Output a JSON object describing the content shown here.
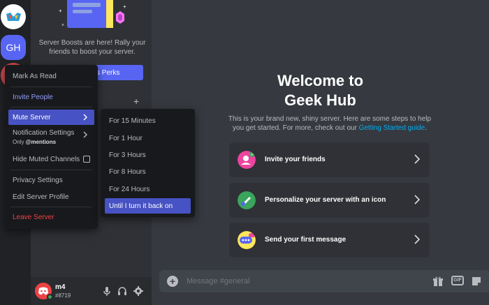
{
  "rail": {
    "server2_initials": "GH"
  },
  "sidebar": {
    "boost_text": "Server Boosts are here! Rally your friends to boost your server.",
    "perks_label": "s Perks"
  },
  "user": {
    "name": "m4",
    "tag": "#8719"
  },
  "main": {
    "welcome_line1": "Welcome to",
    "welcome_line2": "Geek Hub",
    "sub_text": "This is your brand new, shiny server. Here are some steps to help you get started. For more, check out our ",
    "sub_link": "Getting Started guide",
    "sub_end": ".",
    "cards": [
      {
        "label": "Invite your friends",
        "color": "#eb459e"
      },
      {
        "label": "Personalize your server with an icon",
        "color": "#3ba55d"
      },
      {
        "label": "Send your first message",
        "color": "#fee75c"
      }
    ],
    "composer_placeholder": "Message #general",
    "gif_label": "GIF"
  },
  "menu": {
    "mark_read": "Mark As Read",
    "invite": "Invite People",
    "mute": "Mute Server",
    "notifications": "Notification Settings",
    "notif_sub_prefix": "Only ",
    "notif_sub_bold": "@mentions",
    "hide_muted": "Hide Muted Channels",
    "privacy": "Privacy Settings",
    "edit_profile": "Edit Server Profile",
    "leave": "Leave Server"
  },
  "submenu": {
    "items": [
      "For 15 Minutes",
      "For 1 Hour",
      "For 3 Hours",
      "For 8 Hours",
      "For 24 Hours",
      "Until I turn it back on"
    ]
  },
  "colors": {
    "accent": "#5865f2",
    "menu_active": "#4752c4",
    "danger": "#ed4245",
    "online": "#3ba55d",
    "link": "#00aff4"
  }
}
